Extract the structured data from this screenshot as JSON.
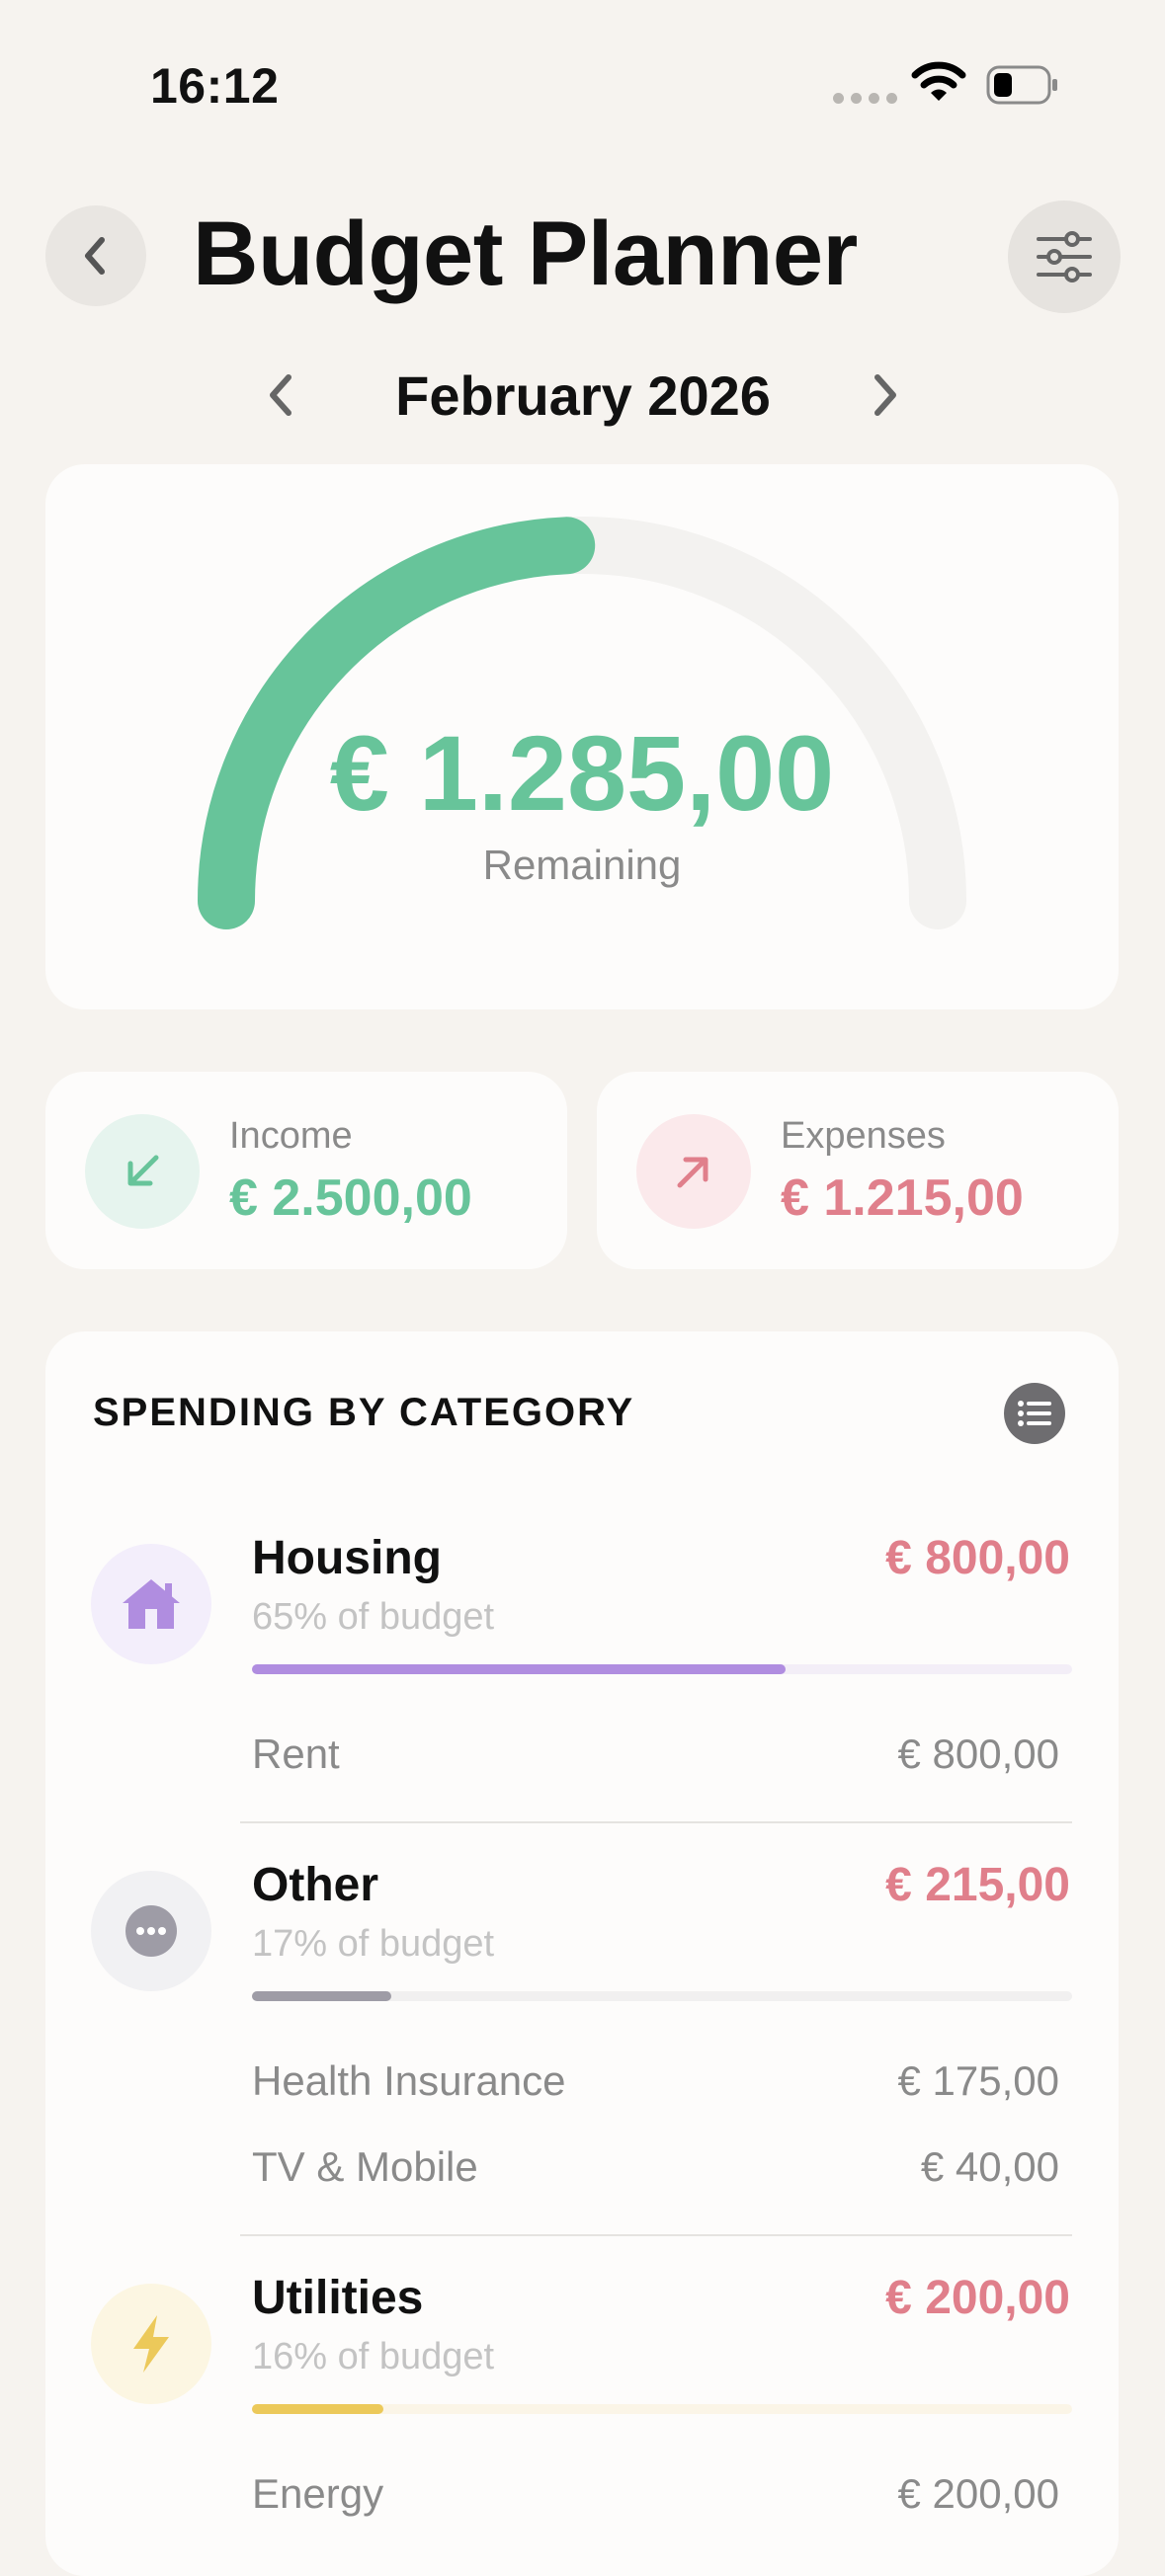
{
  "status_bar": {
    "time": "16:12"
  },
  "header": {
    "title": "Budget Planner"
  },
  "month": {
    "label": "February 2026"
  },
  "summary": {
    "remaining_amount": "€ 1.285,00",
    "remaining_label": "Remaining",
    "spent_fraction": 0.486,
    "gauge_color": "#67c49a",
    "track_color": "#f3f2f0"
  },
  "income": {
    "label": "Income",
    "value": "€ 2.500,00",
    "color": "#67c49a"
  },
  "expenses": {
    "label": "Expenses",
    "value": "€ 1.215,00",
    "color": "#e07f8b"
  },
  "categories_section": {
    "heading": "SPENDING BY CATEGORY",
    "categories": [
      {
        "name": "Housing",
        "amount": "€ 800,00",
        "percent_text": "65% of budget",
        "percent": 0.65,
        "color": "#b08de0",
        "icon": "house-icon",
        "items": [
          {
            "name": "Rent",
            "amount": "€ 800,00"
          }
        ]
      },
      {
        "name": "Other",
        "amount": "€ 215,00",
        "percent_text": "17% of budget",
        "percent": 0.17,
        "color": "#9e9ca6",
        "icon": "ellipsis-icon",
        "items": [
          {
            "name": "Health Insurance",
            "amount": "€ 175,00"
          },
          {
            "name": "TV & Mobile",
            "amount": "€ 40,00"
          }
        ]
      },
      {
        "name": "Utilities",
        "amount": "€ 200,00",
        "percent_text": "16% of budget",
        "percent": 0.16,
        "color": "#ecc95a",
        "icon": "lightning-icon",
        "items": [
          {
            "name": "Energy",
            "amount": "€ 200,00"
          }
        ]
      }
    ]
  }
}
